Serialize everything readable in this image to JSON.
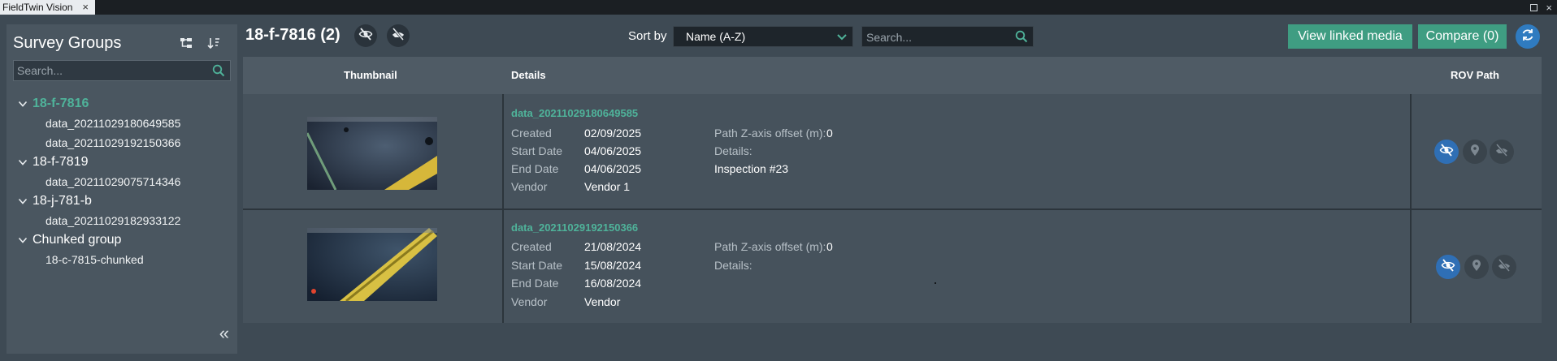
{
  "window": {
    "tab_title": "FieldTwin Vision",
    "close_glyph": "×"
  },
  "sidebar": {
    "title": "Survey Groups",
    "search_placeholder": "Search...",
    "groups": [
      {
        "name": "18-f-7816",
        "active": true,
        "items": [
          "data_20211029180649585",
          "data_20211029192150366"
        ]
      },
      {
        "name": "18-f-7819",
        "active": false,
        "items": [
          "data_20211029075714346"
        ]
      },
      {
        "name": "18-j-781-b",
        "active": false,
        "items": [
          "data_20211029182933122"
        ]
      },
      {
        "name": "Chunked group",
        "active": false,
        "items": [
          "18-c-7815-chunked"
        ]
      }
    ],
    "collapse_glyph": "«"
  },
  "header": {
    "title": "18-f-7816 (2)",
    "sort_label": "Sort by",
    "sort_value": "Name (A-Z)",
    "search_placeholder": "Search...",
    "view_linked_label": "View linked media",
    "compare_label": "Compare (0)"
  },
  "table": {
    "columns": {
      "thumbnail": "Thumbnail",
      "details": "Details",
      "rov_path": "ROV Path"
    },
    "rows": [
      {
        "name": "data_20211029180649585",
        "created_label": "Created",
        "created": "02/09/2025",
        "start_label": "Start Date",
        "start": "04/06/2025",
        "end_label": "End Date",
        "end": "04/06/2025",
        "vendor_label": "Vendor",
        "vendor": "Vendor 1",
        "offset_label": "Path Z-axis offset (m):",
        "offset": "0",
        "details_label": "Details:",
        "details": "Inspection #23"
      },
      {
        "name": "data_20211029192150366",
        "created_label": "Created",
        "created": "21/08/2024",
        "start_label": "Start Date",
        "start": "15/08/2024",
        "end_label": "End Date",
        "end": "16/08/2024",
        "vendor_label": "Vendor",
        "vendor": "Vendor",
        "offset_label": "Path Z-axis offset (m):",
        "offset": "0",
        "details_label": "Details:",
        "details": ""
      }
    ]
  },
  "colors": {
    "accent": "#4fb39a",
    "button_green": "#3f9d82",
    "button_blue": "#2f7bc0",
    "panel": "#4a5660"
  },
  "icons": [
    "close-icon",
    "maximize-icon",
    "hierarchy-icon",
    "sort-icon",
    "search-icon",
    "chevron-down-icon",
    "eye-off-icon",
    "location-pin-icon",
    "refresh-icon",
    "double-chevron-left-icon"
  ]
}
